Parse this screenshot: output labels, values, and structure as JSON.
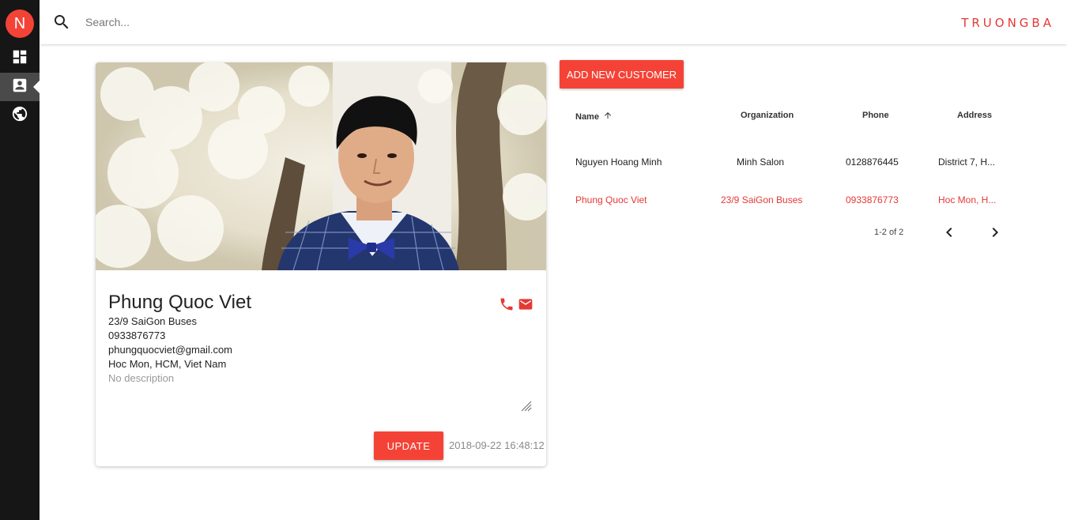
{
  "sidebar": {
    "avatar_letter": "N",
    "items": [
      {
        "icon": "dashboard-icon",
        "active": false
      },
      {
        "icon": "contacts-icon",
        "active": true
      },
      {
        "icon": "globe-icon",
        "active": false
      }
    ]
  },
  "topbar": {
    "search_placeholder": "Search...",
    "brand": "TRUONGBA"
  },
  "customer_card": {
    "name": "Phung Quoc Viet",
    "organization": "23/9 SaiGon Buses",
    "phone": "0933876773",
    "email": "phungquocviet@gmail.com",
    "address": "Hoc Mon, HCM, Viet Nam",
    "description": "No description",
    "update_label": "UPDATE",
    "timestamp": "2018-09-22 16:48:12"
  },
  "customers": {
    "add_label": "ADD NEW CUSTOMER",
    "columns": [
      "Name",
      "Organization",
      "Phone",
      "Address"
    ],
    "rows": [
      {
        "name": "Nguyen Hoang Minh",
        "organization": "Minh Salon",
        "phone": "0128876445",
        "address": "District 7, H...",
        "selected": false
      },
      {
        "name": "Phung Quoc Viet",
        "organization": "23/9 SaiGon Buses",
        "phone": "0933876773",
        "address": "Hoc Mon, H...",
        "selected": true
      }
    ],
    "pagination": "1-2 of 2"
  },
  "colors": {
    "accent": "#f44336",
    "sidebar_bg": "#161616",
    "selected_text": "#e53935"
  }
}
